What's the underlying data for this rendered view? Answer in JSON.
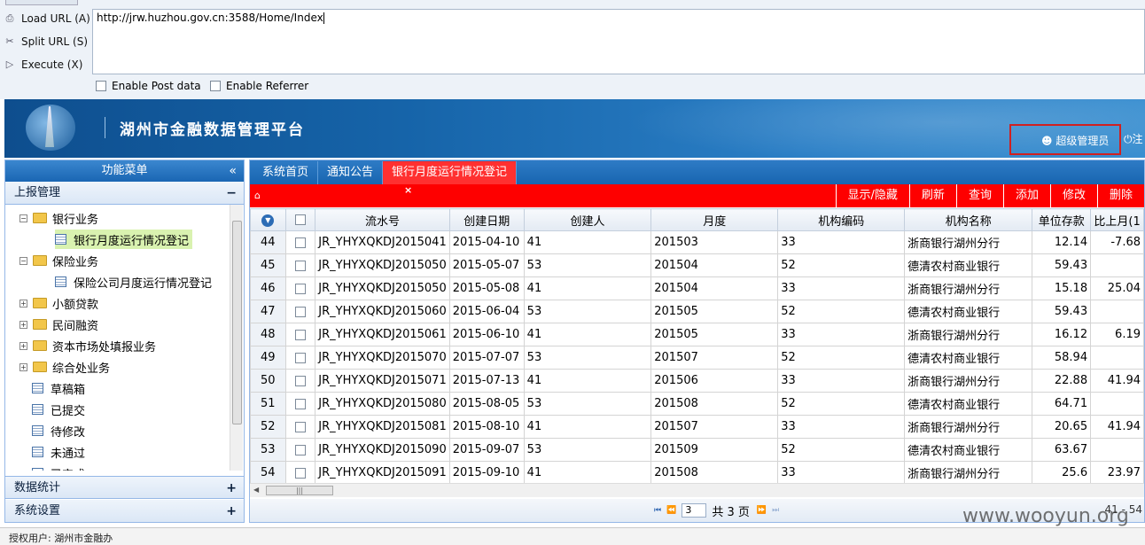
{
  "hackbar": {
    "load_label": "Load URL (A)",
    "split_label": "Split URL (S)",
    "execute_label": "Execute (X)",
    "url": "http://jrw.huzhou.gov.cn:3588/Home/Index",
    "enable_post_label": "Enable Post data",
    "enable_referrer_label": "Enable Referrer"
  },
  "header": {
    "title": "湖州市金融数据管理平台",
    "user_label": "超级管理员",
    "logout_label": "注"
  },
  "sidebar": {
    "title": "功能菜单",
    "collapse_glyph": "«",
    "section_report": "上报管理",
    "tree": [
      {
        "label": "银行业务",
        "type": "folder",
        "expander": "−"
      },
      {
        "label": "银行月度运行情况登记",
        "type": "doc",
        "selected": true
      },
      {
        "label": "保险业务",
        "type": "folder",
        "expander": "−"
      },
      {
        "label": "保险公司月度运行情况登记",
        "type": "doc"
      },
      {
        "label": "小额贷款",
        "type": "folder",
        "expander": "+"
      },
      {
        "label": "民间融资",
        "type": "folder",
        "expander": "+"
      },
      {
        "label": "资本市场处填报业务",
        "type": "folder",
        "expander": "+"
      },
      {
        "label": "综合处业务",
        "type": "folder",
        "expander": "+"
      },
      {
        "label": "草稿箱",
        "type": "doc"
      },
      {
        "label": "已提交",
        "type": "doc"
      },
      {
        "label": "待修改",
        "type": "doc"
      },
      {
        "label": "未通过",
        "type": "doc"
      },
      {
        "label": "已完成",
        "type": "doc"
      }
    ],
    "section_stats": "数据统计",
    "section_settings": "系统设置"
  },
  "tabs": [
    "系统首页",
    "通知公告",
    "银行月度运行情况登记"
  ],
  "toolbar": {
    "buttons": [
      "显示/隐藏",
      "刷新",
      "查询",
      "添加",
      "修改",
      "删除"
    ]
  },
  "grid": {
    "columns": [
      "流水号",
      "创建日期",
      "创建人",
      "月度",
      "机构编码",
      "机构名称",
      "单位存款",
      "比上月(1"
    ],
    "rows": [
      {
        "n": "44",
        "id": "JR_YHYXQKDJ2015041",
        "date": "2015-04-10",
        "creator": "41",
        "month": "201503",
        "code": "33",
        "org": "浙商银行湖州分行",
        "dep": "12.14",
        "mom": "-7.68"
      },
      {
        "n": "45",
        "id": "JR_YHYXQKDJ2015050",
        "date": "2015-05-07",
        "creator": "53",
        "month": "201504",
        "code": "52",
        "org": "德清农村商业银行",
        "dep": "59.43",
        "mom": ""
      },
      {
        "n": "46",
        "id": "JR_YHYXQKDJ2015050",
        "date": "2015-05-08",
        "creator": "41",
        "month": "201504",
        "code": "33",
        "org": "浙商银行湖州分行",
        "dep": "15.18",
        "mom": "25.04"
      },
      {
        "n": "47",
        "id": "JR_YHYXQKDJ2015060",
        "date": "2015-06-04",
        "creator": "53",
        "month": "201505",
        "code": "52",
        "org": "德清农村商业银行",
        "dep": "59.43",
        "mom": ""
      },
      {
        "n": "48",
        "id": "JR_YHYXQKDJ2015061",
        "date": "2015-06-10",
        "creator": "41",
        "month": "201505",
        "code": "33",
        "org": "浙商银行湖州分行",
        "dep": "16.12",
        "mom": "6.19"
      },
      {
        "n": "49",
        "id": "JR_YHYXQKDJ2015070",
        "date": "2015-07-07",
        "creator": "53",
        "month": "201507",
        "code": "52",
        "org": "德清农村商业银行",
        "dep": "58.94",
        "mom": ""
      },
      {
        "n": "50",
        "id": "JR_YHYXQKDJ2015071",
        "date": "2015-07-13",
        "creator": "41",
        "month": "201506",
        "code": "33",
        "org": "浙商银行湖州分行",
        "dep": "22.88",
        "mom": "41.94"
      },
      {
        "n": "51",
        "id": "JR_YHYXQKDJ2015080",
        "date": "2015-08-05",
        "creator": "53",
        "month": "201508",
        "code": "52",
        "org": "德清农村商业银行",
        "dep": "64.71",
        "mom": ""
      },
      {
        "n": "52",
        "id": "JR_YHYXQKDJ2015081",
        "date": "2015-08-10",
        "creator": "41",
        "month": "201507",
        "code": "33",
        "org": "浙商银行湖州分行",
        "dep": "20.65",
        "mom": "41.94"
      },
      {
        "n": "53",
        "id": "JR_YHYXQKDJ2015090",
        "date": "2015-09-07",
        "creator": "53",
        "month": "201509",
        "code": "52",
        "org": "德清农村商业银行",
        "dep": "63.67",
        "mom": ""
      },
      {
        "n": "54",
        "id": "JR_YHYXQKDJ2015091",
        "date": "2015-09-10",
        "creator": "41",
        "month": "201508",
        "code": "33",
        "org": "浙商银行湖州分行",
        "dep": "25.6",
        "mom": "23.97"
      }
    ]
  },
  "pager": {
    "page": "3",
    "total_label": "共 3 页",
    "range": "41 - 54"
  },
  "status": "授权用户: 湖州市金融办",
  "watermark": "www.wooyun.org",
  "colors": {
    "tab_active": "#ff3030",
    "toolbar": "#fe0000",
    "header_blue": "#1865b0"
  }
}
